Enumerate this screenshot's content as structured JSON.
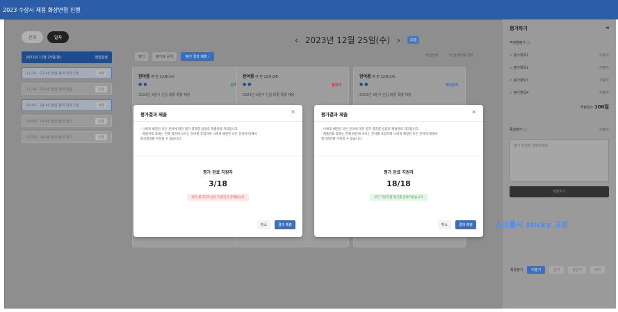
{
  "app": {
    "title": "2023 수상시 채용 화상면접 진행"
  },
  "left": {
    "tabs": [
      {
        "label": "전체"
      },
      {
        "label": "일자"
      }
    ],
    "date_header": {
      "label": "2023년 12월 25일(월)",
      "badge": "면접일정"
    },
    "slots": [
      {
        "time": "11:30 - 12:40",
        "note": "영상 참여 대학 1명",
        "badge": "4명"
      },
      {
        "time": "11:30 - 12:40",
        "note": "영상 참여 없음",
        "badge": "진행"
      },
      {
        "time": "14:00 - 14:40",
        "note": "영상 참여 대학 1명",
        "badge": "4명"
      },
      {
        "time": "13:30 - 14:40",
        "note": "영상 참여 대기",
        "badge": "진행"
      },
      {
        "time": "13:30 - 14:40",
        "note": "영상 참여 대기",
        "badge": "진행"
      }
    ]
  },
  "main": {
    "date_title": "2023년 12월 25일(수)",
    "today_badge": "오늘",
    "prev_icon": "‹",
    "next_icon": "›",
    "toolbar": {
      "filter": "필터",
      "eval_list": "평가표 공개",
      "submit_results": "평가 결과 제출 ›"
    },
    "sort": {
      "label": "수험번호 ⌄",
      "search_placeholder": "Q 검색어를 입력"
    },
    "cards": [
      {
        "name": "한여름",
        "meta": "여 만 22세(24)",
        "result": "합격",
        "result_color": "#2f8a3d",
        "desc": "2023년 3분기 신입 대졸 특별 채용"
      },
      {
        "name": "한여름",
        "meta": "여 만 22세(24)",
        "result": "불합격",
        "result_color": "#c94040",
        "desc": "2023년 3분기 신입 대졸 특별 채용"
      },
      {
        "name": "한여름",
        "meta": "여 만 22세(24)",
        "result": "예비합격",
        "result_color": "#3a6fc0",
        "desc": "2023년 3분기 신입 대졸 특별 채용"
      }
    ]
  },
  "right": {
    "title": "평가하기",
    "section": "역량별평가 ⓘ",
    "items": [
      {
        "label": "평가항목1",
        "value": "미평가"
      },
      {
        "label": "평가항목2",
        "value": "미평가"
      },
      {
        "label": "평가항목3",
        "value": "미평가"
      },
      {
        "label": "평가항목4",
        "value": "미평가"
      }
    ],
    "total_label": "역량점수",
    "total_value": "100점",
    "overall_label": "종합평가 ⓘ",
    "overall_value": "미평가",
    "memo_placeholder": "평가 의견을 입력하세요",
    "submit": "제출하기",
    "sticky_note": "스크롤시 sticky 고정",
    "final_label": "최종평가",
    "final_options": [
      "미평가",
      "합격",
      "불합격",
      "예비"
    ]
  },
  "modals": [
    {
      "title": "평가결과 제출",
      "notes": [
        "· 나에게 배정된 모든 분야에 대한 평가 결과를 일괄로 제출완료 처리합니다.",
        "· 제출완료 후에는 현재 화면에 보이는 분야를 포함하여 나에게 배정된 모든 분야에 대해서",
        "  평가결과를 수정할 수 없습니다."
      ],
      "count_label": "평가 완료 지원자",
      "count": "3/18",
      "status": "아직 평가하지 않은 지원자가 존재합니다",
      "status_type": "red",
      "cancel": "취소",
      "confirm": "결과 제출"
    },
    {
      "title": "평가결과 제출",
      "notes": [
        "· 나에게 배정된 모든 분야에 대한 평가 결과를 일괄로 제출완료 처리합니다.",
        "· 제출완료 후에는 현재 화면에 보이는 분야를 포함하여 나에게 배정된 모든 분야에 대해서",
        "  평가결과를 수정할 수 없습니다."
      ],
      "count_label": "평가 완료 지원자",
      "count": "18/18",
      "status": "모든 지원자를 평가를 완료하였습니다",
      "status_type": "green",
      "cancel": "취소",
      "confirm": "결과 제출"
    }
  ]
}
